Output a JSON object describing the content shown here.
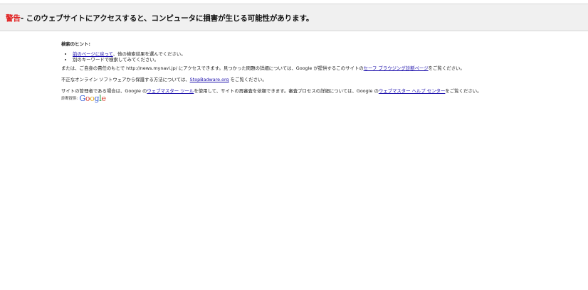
{
  "banner": {
    "warning_label": "警告",
    "message": "- このウェブサイトにアクセスすると、コンピュータに損害が生じる可能性があります。"
  },
  "hints": {
    "title": "検索のヒント:",
    "items": [
      {
        "link": "前のページに戻って",
        "text": "、他の検索結果を選んでください。"
      },
      {
        "link": "",
        "text": "別のキーワードで検索してみてください。"
      }
    ]
  },
  "para1": {
    "text_before": "または、ご自身の責任のもとで http://news.mynavi.jp/ にアクセスできます。見つかった問題の詳細については、Google が提供するこのサイトの",
    "link": "セーフ ブラウジング診断ページ",
    "text_after": "をご覧ください。"
  },
  "para2": {
    "text_before": "不正なオンライン ソフトウェアから保護する方法については、",
    "link": "StopBadware.org",
    "text_after": " をご覧ください。"
  },
  "para3": {
    "text_before": "サイトの管理者である場合は、Google の",
    "link1": "ウェブマスター ツール",
    "text_middle": "を使用して、サイトの再審査を依頼できます。審査プロセスの詳細については、Google の",
    "link2": "ウェブマスター ヘルプ センター",
    "text_after": "をご覧ください。"
  },
  "footer": {
    "label": "診断提供:",
    "logo_text": "Google"
  },
  "colors": {
    "warning": "#e01b1b",
    "link": "#1a0dab"
  }
}
